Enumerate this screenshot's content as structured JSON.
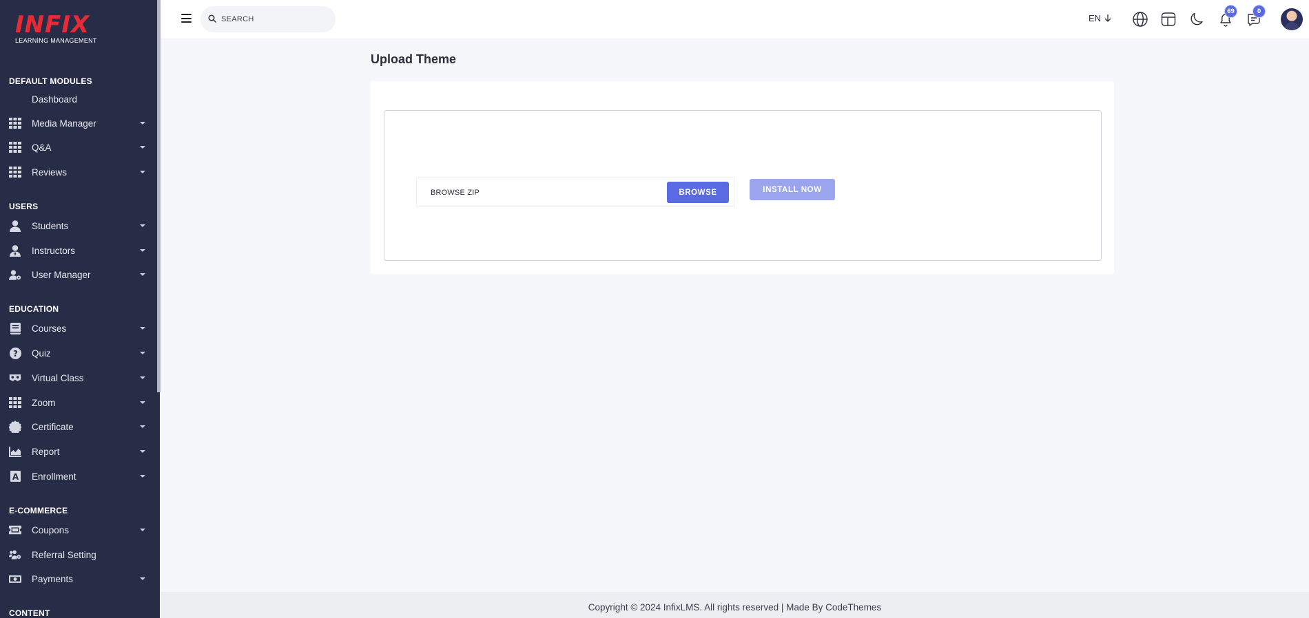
{
  "brand": {
    "logo_text": "INFIX",
    "logo_sub": "LEARNING MANAGEMENT",
    "accent": "#e62b36",
    "primary": "#5a6ae2",
    "sidebar_bg": "#272d47"
  },
  "sidebar": {
    "sections": [
      {
        "title": "DEFAULT MODULES",
        "items": [
          {
            "label": "Dashboard",
            "icon": "none",
            "caret": false
          },
          {
            "label": "Media Manager",
            "icon": "grid-icon",
            "caret": true
          },
          {
            "label": "Q&A",
            "icon": "grid-icon",
            "caret": true
          },
          {
            "label": "Reviews",
            "icon": "grid-icon",
            "caret": true
          }
        ]
      },
      {
        "title": "USERS",
        "items": [
          {
            "label": "Students",
            "icon": "user-icon",
            "caret": true
          },
          {
            "label": "Instructors",
            "icon": "user-tie-icon",
            "caret": true
          },
          {
            "label": "User Manager",
            "icon": "user-gear-icon",
            "caret": true
          }
        ]
      },
      {
        "title": "EDUCATION",
        "items": [
          {
            "label": "Courses",
            "icon": "book-icon",
            "caret": true
          },
          {
            "label": "Quiz",
            "icon": "question-icon",
            "caret": true
          },
          {
            "label": "Virtual Class",
            "icon": "vr-icon",
            "caret": true
          },
          {
            "label": "Zoom",
            "icon": "grid-icon",
            "caret": true
          },
          {
            "label": "Certificate",
            "icon": "certificate-icon",
            "caret": true
          },
          {
            "label": "Report",
            "icon": "chart-icon",
            "caret": true
          },
          {
            "label": "Enrollment",
            "icon": "enrollment-icon",
            "caret": true
          }
        ]
      },
      {
        "title": "E-COMMERCE",
        "items": [
          {
            "label": "Coupons",
            "icon": "ticket-icon",
            "caret": true
          },
          {
            "label": "Referral Setting",
            "icon": "users-gear-icon",
            "caret": false
          },
          {
            "label": "Payments",
            "icon": "money-icon",
            "caret": true
          }
        ]
      },
      {
        "title": "CONTENT",
        "items": []
      }
    ]
  },
  "header": {
    "search_placeholder": "SEARCH",
    "language": "EN",
    "notifications_count": "69",
    "messages_count": "0"
  },
  "main": {
    "title": "Upload Theme",
    "file_placeholder": "BROWSE ZIP",
    "browse_label": "BROWSE",
    "install_label": "INSTALL NOW"
  },
  "footer": {
    "text": "Copyright © 2024 InfixLMS. All rights reserved | Made By CodeThemes"
  }
}
